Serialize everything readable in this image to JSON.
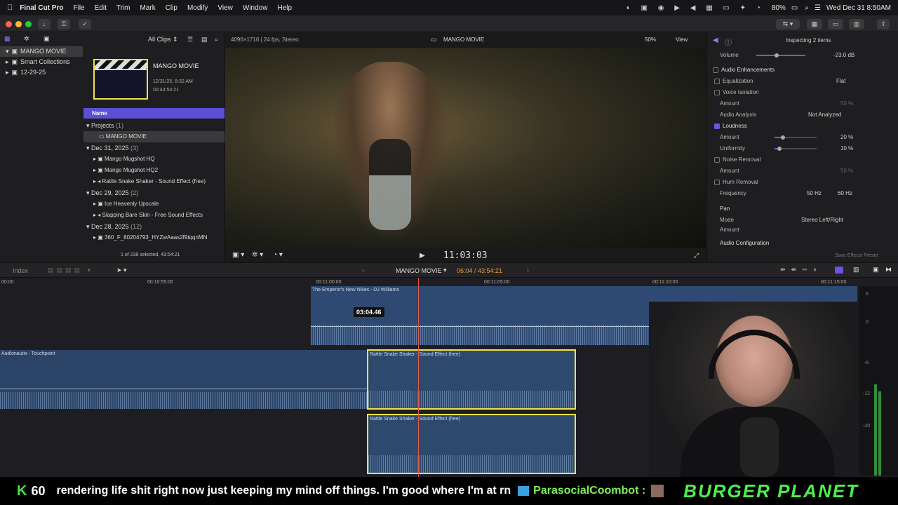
{
  "menubar": {
    "app": "Final Cut Pro",
    "items": [
      "File",
      "Edit",
      "Trim",
      "Mark",
      "Clip",
      "Modify",
      "View",
      "Window",
      "Help"
    ],
    "battery": "80%",
    "datetime": "Wed Dec 31  8:50AM"
  },
  "browser": {
    "clip_filter": "All Clips",
    "library": "MANGO MOVIE",
    "smart_collections": "Smart Collections",
    "event": "12-29-25",
    "preview_title": "MANGO MOVIE",
    "preview_date": "12/31/25, 8:32 AM",
    "preview_duration": "00:43:54:21",
    "col_header": "Name",
    "groups": [
      {
        "label": "Projects",
        "count": "(1)",
        "items": [
          "MANGO MOVIE"
        ]
      },
      {
        "label": "Dec 31, 2025",
        "count": "(3)",
        "items": [
          "Mango Mugshot HQ",
          "Mango Mugshot HQ2",
          "Rattle Snake Shaker - Sound Effect (free)"
        ]
      },
      {
        "label": "Dec 29, 2025",
        "count": "(2)",
        "items": [
          "Ice Heavenly Upscale",
          "Slapping Bare Skin - Free Sound Effects"
        ]
      },
      {
        "label": "Dec 28, 2025",
        "count": "(12)",
        "items": [
          "360_F_80204793_HYZwAaas2f9tqqnMN"
        ]
      }
    ],
    "status": "1 of 238 selected, 43:54:21"
  },
  "viewer": {
    "format": "4096×1716 | 24 fps, Stereo",
    "title": "MANGO MOVIE",
    "zoom": "50%",
    "view_label": "View",
    "timecode": "11:03:03"
  },
  "inspector": {
    "header": "Inspecting 2 items",
    "volume_label": "Volume",
    "volume_value": "-23.0  dB",
    "section": "Audio Enhancements",
    "equalization": "Equalization",
    "eq_value": "Flat",
    "voice_isolation": "Voice Isolation",
    "amount": "Amount",
    "amount_value_dim": "50  %",
    "audio_analysis": "Audio Analysis",
    "analysis_value": "Not Analyzed",
    "loudness": "Loudness",
    "loud_amount": "Amount",
    "loud_amount_value": "20  %",
    "uniformity": "Uniformity",
    "uniformity_value": "10  %",
    "noise_removal": "Noise Removal",
    "noise_amount": "Amount",
    "noise_amount_value": "50  %",
    "hum_removal": "Hum Removal",
    "frequency": "Frequency",
    "freq_50": "50 Hz",
    "freq_60": "60 Hz",
    "pan": "Pan",
    "mode": "Mode",
    "mode_value": "Stereo Left/Right",
    "pan_amount": "Amount",
    "audio_config": "Audio Configuration",
    "save_preset": "Save Effects Preset"
  },
  "timeline": {
    "index": "Index",
    "project": "MANGO MOVIE",
    "position": "06:04 / 43:54:21",
    "ruler": [
      "00:00",
      "00:10:55:00",
      "00:11:00:00",
      "00:11:05:00",
      "00:11:10:00",
      "00:11:15:00"
    ],
    "music_clip": "The Emperor's New Nikes - DJ Williams",
    "tooltip": "03:04.46",
    "ambient_clip": "Audionautix - Touchpoint",
    "sfx_clip": "Rattle Snake Shaker - Sound Effect (free)",
    "meter_labels": [
      "6",
      "0",
      "-6",
      "-12",
      "-20"
    ]
  },
  "ticker": {
    "count": "60",
    "message": "rendering life shit right now just keeping my mind off things. I'm good where I'm at rn",
    "user": "ParasocialCoombot :",
    "brand": "BURGER PLANET"
  },
  "colors": {
    "accent": "#6a55e0",
    "clip_blue": "#2d4a6e",
    "selection_yellow": "#f0e14a",
    "playhead": "#e05a4a"
  }
}
